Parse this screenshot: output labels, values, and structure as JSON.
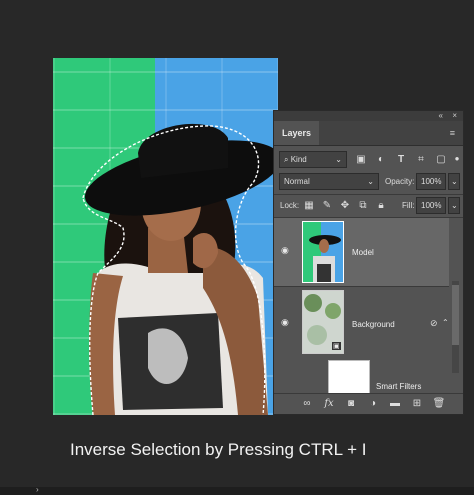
{
  "layers_panel": {
    "tab_label": "Layers",
    "collapse_glyph": "«",
    "close_glyph": "×",
    "menu_glyph": "≡",
    "filter": {
      "icon": "search-icon",
      "value": "Kind"
    },
    "blend_mode": "Normal",
    "opacity_label": "Opacity:",
    "opacity_value": "100%",
    "lock_label": "Lock:",
    "fill_label": "Fill:",
    "fill_value": "100%",
    "layers": [
      {
        "name": "Model",
        "selected": true
      },
      {
        "name": "Background",
        "selected": false
      },
      {
        "name": "Smart Filters",
        "selected": false
      }
    ],
    "bottom_icons": [
      "link-icon",
      "fx-icon",
      "mask-icon",
      "adjustment-icon",
      "folder-icon",
      "new-layer-icon",
      "trash-icon"
    ],
    "fx_label": "fx"
  },
  "caption": "Inverse Selection by Pressing CTRL + I",
  "colors": {
    "wall_green": "#2fc97a",
    "wall_blue": "#4aa3e6",
    "panel_bg": "#535353",
    "selected_layer": "#676767"
  }
}
